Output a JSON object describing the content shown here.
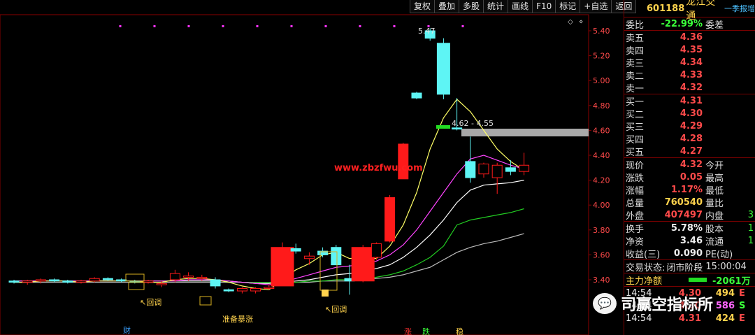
{
  "toolbar": [
    "复权",
    "叠加",
    "多股",
    "统计",
    "画线",
    "F10",
    "标记",
    "+自选",
    "返回"
  ],
  "stock": {
    "code": "601188",
    "name": "龙江交通",
    "report_tag": "一季报增"
  },
  "quote": {
    "weibi": {
      "label": "委比",
      "value": "-22.99%",
      "label2": "委差"
    },
    "sell": [
      {
        "label": "卖五",
        "price": "4.36"
      },
      {
        "label": "卖四",
        "price": "4.35"
      },
      {
        "label": "卖三",
        "price": "4.34"
      },
      {
        "label": "卖二",
        "price": "4.33"
      },
      {
        "label": "卖一",
        "price": "4.32"
      }
    ],
    "buy": [
      {
        "label": "买一",
        "price": "4.31"
      },
      {
        "label": "买二",
        "price": "4.30"
      },
      {
        "label": "买三",
        "price": "4.29"
      },
      {
        "label": "买四",
        "price": "4.28"
      },
      {
        "label": "买五",
        "price": "4.27"
      }
    ],
    "stats": [
      {
        "label": "现价",
        "value": "4.32",
        "label2": "今开"
      },
      {
        "label": "涨跌",
        "value": "0.05",
        "label2": "最高"
      },
      {
        "label": "涨幅",
        "value": "1.17%",
        "label2": "最低"
      },
      {
        "label": "总量",
        "value": "760540",
        "label2": "量比"
      },
      {
        "label": "外盘",
        "value": "407497",
        "label2": "内盘",
        "tail": "3"
      }
    ],
    "stats2": [
      {
        "label": "换手",
        "value": "5.78%",
        "label2": "股本",
        "tail": "1"
      },
      {
        "label": "净资",
        "value": "3.46",
        "label2": "流通",
        "tail": "1"
      },
      {
        "label": "收益(三)",
        "value": "0.090",
        "label2": "PE(动)"
      }
    ],
    "trade_status": {
      "label": "交易状态:",
      "value": "闭市阶段",
      "time": "15:00:04"
    },
    "main_flow": {
      "label": "主力净额",
      "value": "-2061万"
    },
    "ticks": [
      {
        "time": "14:54",
        "price": "4.30",
        "vol": "494",
        "flag": "E"
      },
      {
        "time": "14:54",
        "price": "4.30",
        "vol": "586",
        "flag": "S"
      },
      {
        "time": "14:54",
        "price": "4.31",
        "vol": "424",
        "flag": "E"
      }
    ]
  },
  "chart_labels": {
    "high": "5.47",
    "range": "4.62 - 4.55",
    "watermark": "www.zbzfwu.com",
    "pullback1": "↖回调",
    "prepare": "准备暴涨",
    "pullback2": "↖回调",
    "cai": "财",
    "zhang": "涨",
    "die": "跌",
    "wen": "稳"
  },
  "wechat_watermark": "司赢空指标所",
  "chart_data": {
    "type": "candlestick",
    "y_ticks": [
      "5.40",
      "5.20",
      "5.00",
      "4.80",
      "4.60",
      "4.40",
      "4.20",
      "4.00",
      "3.80",
      "3.60",
      "3.40"
    ],
    "ylim": [
      3.31,
      5.48
    ],
    "colors": {
      "up": "#ff1a1a",
      "down": "#5ef5f5",
      "ma1": "#ffff66",
      "ma2": "#ff44ff",
      "ma3": "#ffffff",
      "ma4": "#22cc22",
      "ma5": "#bbbbbb"
    },
    "candles": [
      {
        "i": 0,
        "o": 3.39,
        "h": 3.4,
        "l": 3.37,
        "c": 3.38
      },
      {
        "i": 1,
        "o": 3.38,
        "h": 3.4,
        "l": 3.36,
        "c": 3.39
      },
      {
        "i": 2,
        "o": 3.39,
        "h": 3.41,
        "l": 3.37,
        "c": 3.4
      },
      {
        "i": 3,
        "o": 3.4,
        "h": 3.41,
        "l": 3.38,
        "c": 3.39
      },
      {
        "i": 4,
        "o": 3.39,
        "h": 3.4,
        "l": 3.37,
        "c": 3.38
      },
      {
        "i": 5,
        "o": 3.38,
        "h": 3.4,
        "l": 3.37,
        "c": 3.39
      },
      {
        "i": 6,
        "o": 3.39,
        "h": 3.42,
        "l": 3.38,
        "c": 3.41
      },
      {
        "i": 7,
        "o": 3.41,
        "h": 3.42,
        "l": 3.39,
        "c": 3.4
      },
      {
        "i": 8,
        "o": 3.4,
        "h": 3.41,
        "l": 3.38,
        "c": 3.39
      },
      {
        "i": 9,
        "o": 3.39,
        "h": 3.4,
        "l": 3.37,
        "c": 3.38
      },
      {
        "i": 10,
        "o": 3.38,
        "h": 3.4,
        "l": 3.37,
        "c": 3.39
      },
      {
        "i": 11,
        "o": 3.36,
        "h": 3.39,
        "l": 3.34,
        "c": 3.37
      },
      {
        "i": 12,
        "o": 3.4,
        "h": 3.48,
        "l": 3.38,
        "c": 3.45
      },
      {
        "i": 13,
        "o": 3.42,
        "h": 3.46,
        "l": 3.39,
        "c": 3.43
      },
      {
        "i": 14,
        "o": 3.41,
        "h": 3.44,
        "l": 3.39,
        "c": 3.42
      },
      {
        "i": 15,
        "o": 3.4,
        "h": 3.42,
        "l": 3.33,
        "c": 3.35
      },
      {
        "i": 16,
        "o": 3.32,
        "h": 3.33,
        "l": 3.3,
        "c": 3.31
      },
      {
        "i": 17,
        "o": 3.31,
        "h": 3.34,
        "l": 3.29,
        "c": 3.33
      },
      {
        "i": 18,
        "o": 3.31,
        "h": 3.34,
        "l": 3.29,
        "c": 3.33
      },
      {
        "i": 19,
        "o": 3.33,
        "h": 3.36,
        "l": 3.32,
        "c": 3.34
      },
      {
        "i": 20,
        "o": 3.35,
        "h": 3.7,
        "l": 3.35,
        "c": 3.66
      },
      {
        "i": 21,
        "o": 3.65,
        "h": 3.69,
        "l": 3.61,
        "c": 3.63
      },
      {
        "i": 22,
        "o": 3.57,
        "h": 3.62,
        "l": 3.52,
        "c": 3.59
      },
      {
        "i": 23,
        "o": 3.63,
        "h": 3.66,
        "l": 3.58,
        "c": 3.6
      },
      {
        "i": 24,
        "o": 3.66,
        "h": 3.68,
        "l": 3.52,
        "c": 3.52
      },
      {
        "i": 25,
        "o": 3.41,
        "h": 3.52,
        "l": 3.28,
        "c": 3.39
      },
      {
        "i": 26,
        "o": 3.39,
        "h": 3.68,
        "l": 3.38,
        "c": 3.66
      },
      {
        "i": 27,
        "o": 3.58,
        "h": 3.7,
        "l": 3.56,
        "c": 3.69
      },
      {
        "i": 28,
        "o": 3.71,
        "h": 4.08,
        "l": 3.7,
        "c": 4.06
      },
      {
        "i": 29,
        "o": 4.21,
        "h": 4.5,
        "l": 4.21,
        "c": 4.49
      },
      {
        "i": 30,
        "o": 4.9,
        "h": 4.91,
        "l": 4.85,
        "c": 4.86
      },
      {
        "i": 31,
        "o": 5.4,
        "h": 5.42,
        "l": 5.32,
        "c": 5.34
      },
      {
        "i": 32,
        "o": 5.3,
        "h": 5.34,
        "l": 4.85,
        "c": 4.89
      },
      {
        "i": 33,
        "o": 4.62,
        "h": 4.86,
        "l": 4.6,
        "c": 4.61
      },
      {
        "i": 34,
        "o": 4.35,
        "h": 4.55,
        "l": 4.18,
        "c": 4.22
      },
      {
        "i": 35,
        "o": 4.25,
        "h": 4.34,
        "l": 4.22,
        "c": 4.33
      },
      {
        "i": 36,
        "o": 4.22,
        "h": 4.34,
        "l": 4.09,
        "c": 4.32
      },
      {
        "i": 37,
        "o": 4.3,
        "h": 4.36,
        "l": 4.24,
        "c": 4.27
      },
      {
        "i": 38,
        "o": 4.27,
        "h": 4.42,
        "l": 4.24,
        "c": 4.32
      }
    ],
    "ma1": [
      3.38,
      3.38,
      3.39,
      3.39,
      3.39,
      3.38,
      3.39,
      3.39,
      3.39,
      3.39,
      3.38,
      3.38,
      3.4,
      3.41,
      3.41,
      3.4,
      3.38,
      3.35,
      3.33,
      3.32,
      3.4,
      3.48,
      3.53,
      3.6,
      3.62,
      3.57,
      3.58,
      3.57,
      3.67,
      3.84,
      4.1,
      4.45,
      4.7,
      4.85,
      4.75,
      4.6,
      4.45,
      4.35,
      4.28
    ],
    "ma2": [
      3.39,
      3.39,
      3.39,
      3.39,
      3.39,
      3.39,
      3.39,
      3.39,
      3.39,
      3.39,
      3.39,
      3.39,
      3.39,
      3.4,
      3.4,
      3.4,
      3.39,
      3.38,
      3.37,
      3.36,
      3.38,
      3.41,
      3.44,
      3.47,
      3.5,
      3.51,
      3.53,
      3.55,
      3.6,
      3.68,
      3.8,
      3.95,
      4.1,
      4.25,
      4.37,
      4.4,
      4.36,
      4.32,
      4.29
    ],
    "ma3": [
      3.39,
      3.39,
      3.39,
      3.39,
      3.39,
      3.39,
      3.39,
      3.39,
      3.39,
      3.39,
      3.39,
      3.39,
      3.39,
      3.39,
      3.39,
      3.39,
      3.39,
      3.38,
      3.37,
      3.37,
      3.38,
      3.39,
      3.4,
      3.42,
      3.44,
      3.45,
      3.47,
      3.49,
      3.52,
      3.58,
      3.66,
      3.76,
      3.88,
      4.02,
      4.12,
      4.16,
      4.17,
      4.18,
      4.2
    ],
    "ma4": [
      3.39,
      3.39,
      3.39,
      3.39,
      3.39,
      3.39,
      3.39,
      3.39,
      3.39,
      3.39,
      3.39,
      3.39,
      3.39,
      3.39,
      3.39,
      3.39,
      3.39,
      3.38,
      3.38,
      3.38,
      3.38,
      3.38,
      3.39,
      3.39,
      3.4,
      3.4,
      3.41,
      3.42,
      3.44,
      3.47,
      3.52,
      3.58,
      3.67,
      3.84,
      3.88,
      3.9,
      3.92,
      3.94,
      3.97
    ],
    "ma5": [
      3.38,
      3.38,
      3.38,
      3.38,
      3.38,
      3.38,
      3.38,
      3.38,
      3.38,
      3.38,
      3.38,
      3.38,
      3.38,
      3.38,
      3.38,
      3.38,
      3.38,
      3.38,
      3.38,
      3.38,
      3.38,
      3.38,
      3.38,
      3.39,
      3.39,
      3.39,
      3.4,
      3.41,
      3.42,
      3.44,
      3.47,
      3.5,
      3.56,
      3.62,
      3.66,
      3.69,
      3.71,
      3.74,
      3.77
    ]
  }
}
